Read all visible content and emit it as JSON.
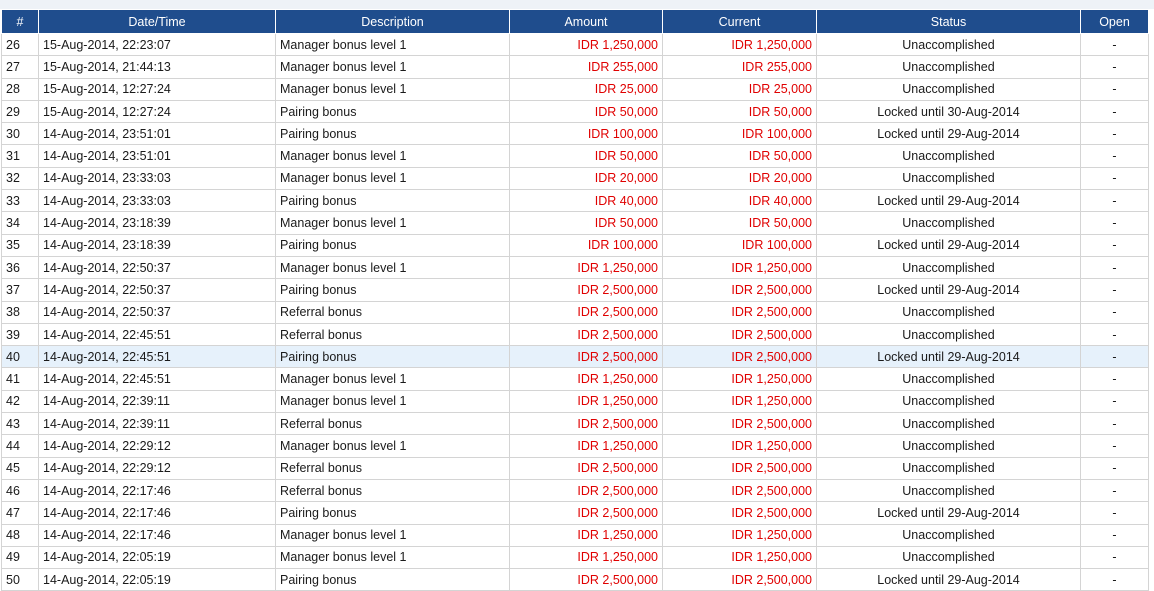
{
  "table": {
    "headers": [
      "#",
      "Date/Time",
      "Description",
      "Amount",
      "Current",
      "Status",
      "Open"
    ],
    "rows": [
      {
        "num": "26",
        "datetime": "15-Aug-2014, 22:23:07",
        "description": "Manager bonus level 1",
        "amount": "IDR 1,250,000",
        "current": "IDR 1,250,000",
        "status": "Unaccomplished",
        "open": "-"
      },
      {
        "num": "27",
        "datetime": "15-Aug-2014, 21:44:13",
        "description": "Manager bonus level 1",
        "amount": "IDR 255,000",
        "current": "IDR 255,000",
        "status": "Unaccomplished",
        "open": "-"
      },
      {
        "num": "28",
        "datetime": "15-Aug-2014, 12:27:24",
        "description": "Manager bonus level 1",
        "amount": "IDR 25,000",
        "current": "IDR 25,000",
        "status": "Unaccomplished",
        "open": "-"
      },
      {
        "num": "29",
        "datetime": "15-Aug-2014, 12:27:24",
        "description": "Pairing bonus",
        "amount": "IDR 50,000",
        "current": "IDR 50,000",
        "status": "Locked until 30-Aug-2014",
        "open": "-"
      },
      {
        "num": "30",
        "datetime": "14-Aug-2014, 23:51:01",
        "description": "Pairing bonus",
        "amount": "IDR 100,000",
        "current": "IDR 100,000",
        "status": "Locked until 29-Aug-2014",
        "open": "-"
      },
      {
        "num": "31",
        "datetime": "14-Aug-2014, 23:51:01",
        "description": "Manager bonus level 1",
        "amount": "IDR 50,000",
        "current": "IDR 50,000",
        "status": "Unaccomplished",
        "open": "-"
      },
      {
        "num": "32",
        "datetime": "14-Aug-2014, 23:33:03",
        "description": "Manager bonus level 1",
        "amount": "IDR 20,000",
        "current": "IDR 20,000",
        "status": "Unaccomplished",
        "open": "-"
      },
      {
        "num": "33",
        "datetime": "14-Aug-2014, 23:33:03",
        "description": "Pairing bonus",
        "amount": "IDR 40,000",
        "current": "IDR 40,000",
        "status": "Locked until 29-Aug-2014",
        "open": "-"
      },
      {
        "num": "34",
        "datetime": "14-Aug-2014, 23:18:39",
        "description": "Manager bonus level 1",
        "amount": "IDR 50,000",
        "current": "IDR 50,000",
        "status": "Unaccomplished",
        "open": "-"
      },
      {
        "num": "35",
        "datetime": "14-Aug-2014, 23:18:39",
        "description": "Pairing bonus",
        "amount": "IDR 100,000",
        "current": "IDR 100,000",
        "status": "Locked until 29-Aug-2014",
        "open": "-"
      },
      {
        "num": "36",
        "datetime": "14-Aug-2014, 22:50:37",
        "description": "Manager bonus level 1",
        "amount": "IDR 1,250,000",
        "current": "IDR 1,250,000",
        "status": "Unaccomplished",
        "open": "-"
      },
      {
        "num": "37",
        "datetime": "14-Aug-2014, 22:50:37",
        "description": "Pairing bonus",
        "amount": "IDR 2,500,000",
        "current": "IDR 2,500,000",
        "status": "Locked until 29-Aug-2014",
        "open": "-"
      },
      {
        "num": "38",
        "datetime": "14-Aug-2014, 22:50:37",
        "description": "Referral bonus",
        "amount": "IDR 2,500,000",
        "current": "IDR 2,500,000",
        "status": "Unaccomplished",
        "open": "-"
      },
      {
        "num": "39",
        "datetime": "14-Aug-2014, 22:45:51",
        "description": "Referral bonus",
        "amount": "IDR 2,500,000",
        "current": "IDR 2,500,000",
        "status": "Unaccomplished",
        "open": "-"
      },
      {
        "num": "40",
        "datetime": "14-Aug-2014, 22:45:51",
        "description": "Pairing bonus",
        "amount": "IDR 2,500,000",
        "current": "IDR 2,500,000",
        "status": "Locked until 29-Aug-2014",
        "open": "-"
      },
      {
        "num": "41",
        "datetime": "14-Aug-2014, 22:45:51",
        "description": "Manager bonus level 1",
        "amount": "IDR 1,250,000",
        "current": "IDR 1,250,000",
        "status": "Unaccomplished",
        "open": "-"
      },
      {
        "num": "42",
        "datetime": "14-Aug-2014, 22:39:11",
        "description": "Manager bonus level 1",
        "amount": "IDR 1,250,000",
        "current": "IDR 1,250,000",
        "status": "Unaccomplished",
        "open": "-"
      },
      {
        "num": "43",
        "datetime": "14-Aug-2014, 22:39:11",
        "description": "Referral bonus",
        "amount": "IDR 2,500,000",
        "current": "IDR 2,500,000",
        "status": "Unaccomplished",
        "open": "-"
      },
      {
        "num": "44",
        "datetime": "14-Aug-2014, 22:29:12",
        "description": "Manager bonus level 1",
        "amount": "IDR 1,250,000",
        "current": "IDR 1,250,000",
        "status": "Unaccomplished",
        "open": "-"
      },
      {
        "num": "45",
        "datetime": "14-Aug-2014, 22:29:12",
        "description": "Referral bonus",
        "amount": "IDR 2,500,000",
        "current": "IDR 2,500,000",
        "status": "Unaccomplished",
        "open": "-"
      },
      {
        "num": "46",
        "datetime": "14-Aug-2014, 22:17:46",
        "description": "Referral bonus",
        "amount": "IDR 2,500,000",
        "current": "IDR 2,500,000",
        "status": "Unaccomplished",
        "open": "-"
      },
      {
        "num": "47",
        "datetime": "14-Aug-2014, 22:17:46",
        "description": "Pairing bonus",
        "amount": "IDR 2,500,000",
        "current": "IDR 2,500,000",
        "status": "Locked until 29-Aug-2014",
        "open": "-"
      },
      {
        "num": "48",
        "datetime": "14-Aug-2014, 22:17:46",
        "description": "Manager bonus level 1",
        "amount": "IDR 1,250,000",
        "current": "IDR 1,250,000",
        "status": "Unaccomplished",
        "open": "-"
      },
      {
        "num": "49",
        "datetime": "14-Aug-2014, 22:05:19",
        "description": "Manager bonus level 1",
        "amount": "IDR 1,250,000",
        "current": "IDR 1,250,000",
        "status": "Unaccomplished",
        "open": "-"
      },
      {
        "num": "50",
        "datetime": "14-Aug-2014, 22:05:19",
        "description": "Pairing bonus",
        "amount": "IDR 2,500,000",
        "current": "IDR 2,500,000",
        "status": "Locked until 29-Aug-2014",
        "open": "-"
      }
    ],
    "highlighted_row": "40"
  },
  "colors": {
    "header_bg": "#1f4d8d",
    "header_text": "#ffffff",
    "amount_text": "#e00000",
    "highlight_row": "#e6f1fb",
    "grid_line": "#d4d4d4"
  }
}
